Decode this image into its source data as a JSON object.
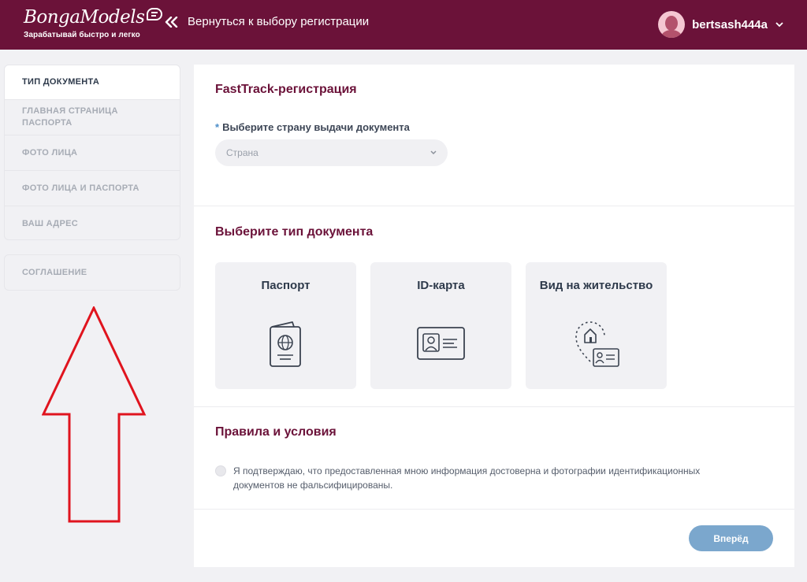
{
  "header": {
    "logo_text": "BongaModels",
    "logo_tagline": "Зарабатывай быстро и легко",
    "back_label": "Вернуться к выбору регистрации",
    "username": "bertsash444a"
  },
  "sidebar": {
    "steps": [
      {
        "label": "ТИП ДОКУМЕНТА",
        "active": true
      },
      {
        "label": "ГЛАВНАЯ СТРАНИЦА ПАСПОРТА",
        "active": false
      },
      {
        "label": "ФОТО ЛИЦА",
        "active": false
      },
      {
        "label": "ФОТО ЛИЦА И ПАСПОРТА",
        "active": false
      },
      {
        "label": "ВАШ АДРЕС",
        "active": false
      }
    ],
    "agreement": "СОГЛАШЕНИЕ"
  },
  "main": {
    "fasttrack_title": "FastTrack-регистрация",
    "required_mark": "*",
    "country_label": "Выберите страну выдачи документа",
    "country_placeholder": "Страна",
    "doc_type_title": "Выберите тип документа",
    "doc_types": [
      {
        "label": "Паспорт",
        "icon": "passport-icon"
      },
      {
        "label": "ID-карта",
        "icon": "id-card-icon"
      },
      {
        "label": "Вид на жительство",
        "icon": "residence-permit-icon"
      }
    ],
    "terms_title": "Правила и условия",
    "terms_text": "Я подтверждаю, что предоставленная мною информация достоверна и фотографии идентификационных документов не фальсифицированы.",
    "next_label": "Вперёд"
  },
  "colors": {
    "header_bg": "#6b1239",
    "accent": "#6b1239",
    "button": "#7ba7cd",
    "annotation_arrow": "#e0141e"
  }
}
